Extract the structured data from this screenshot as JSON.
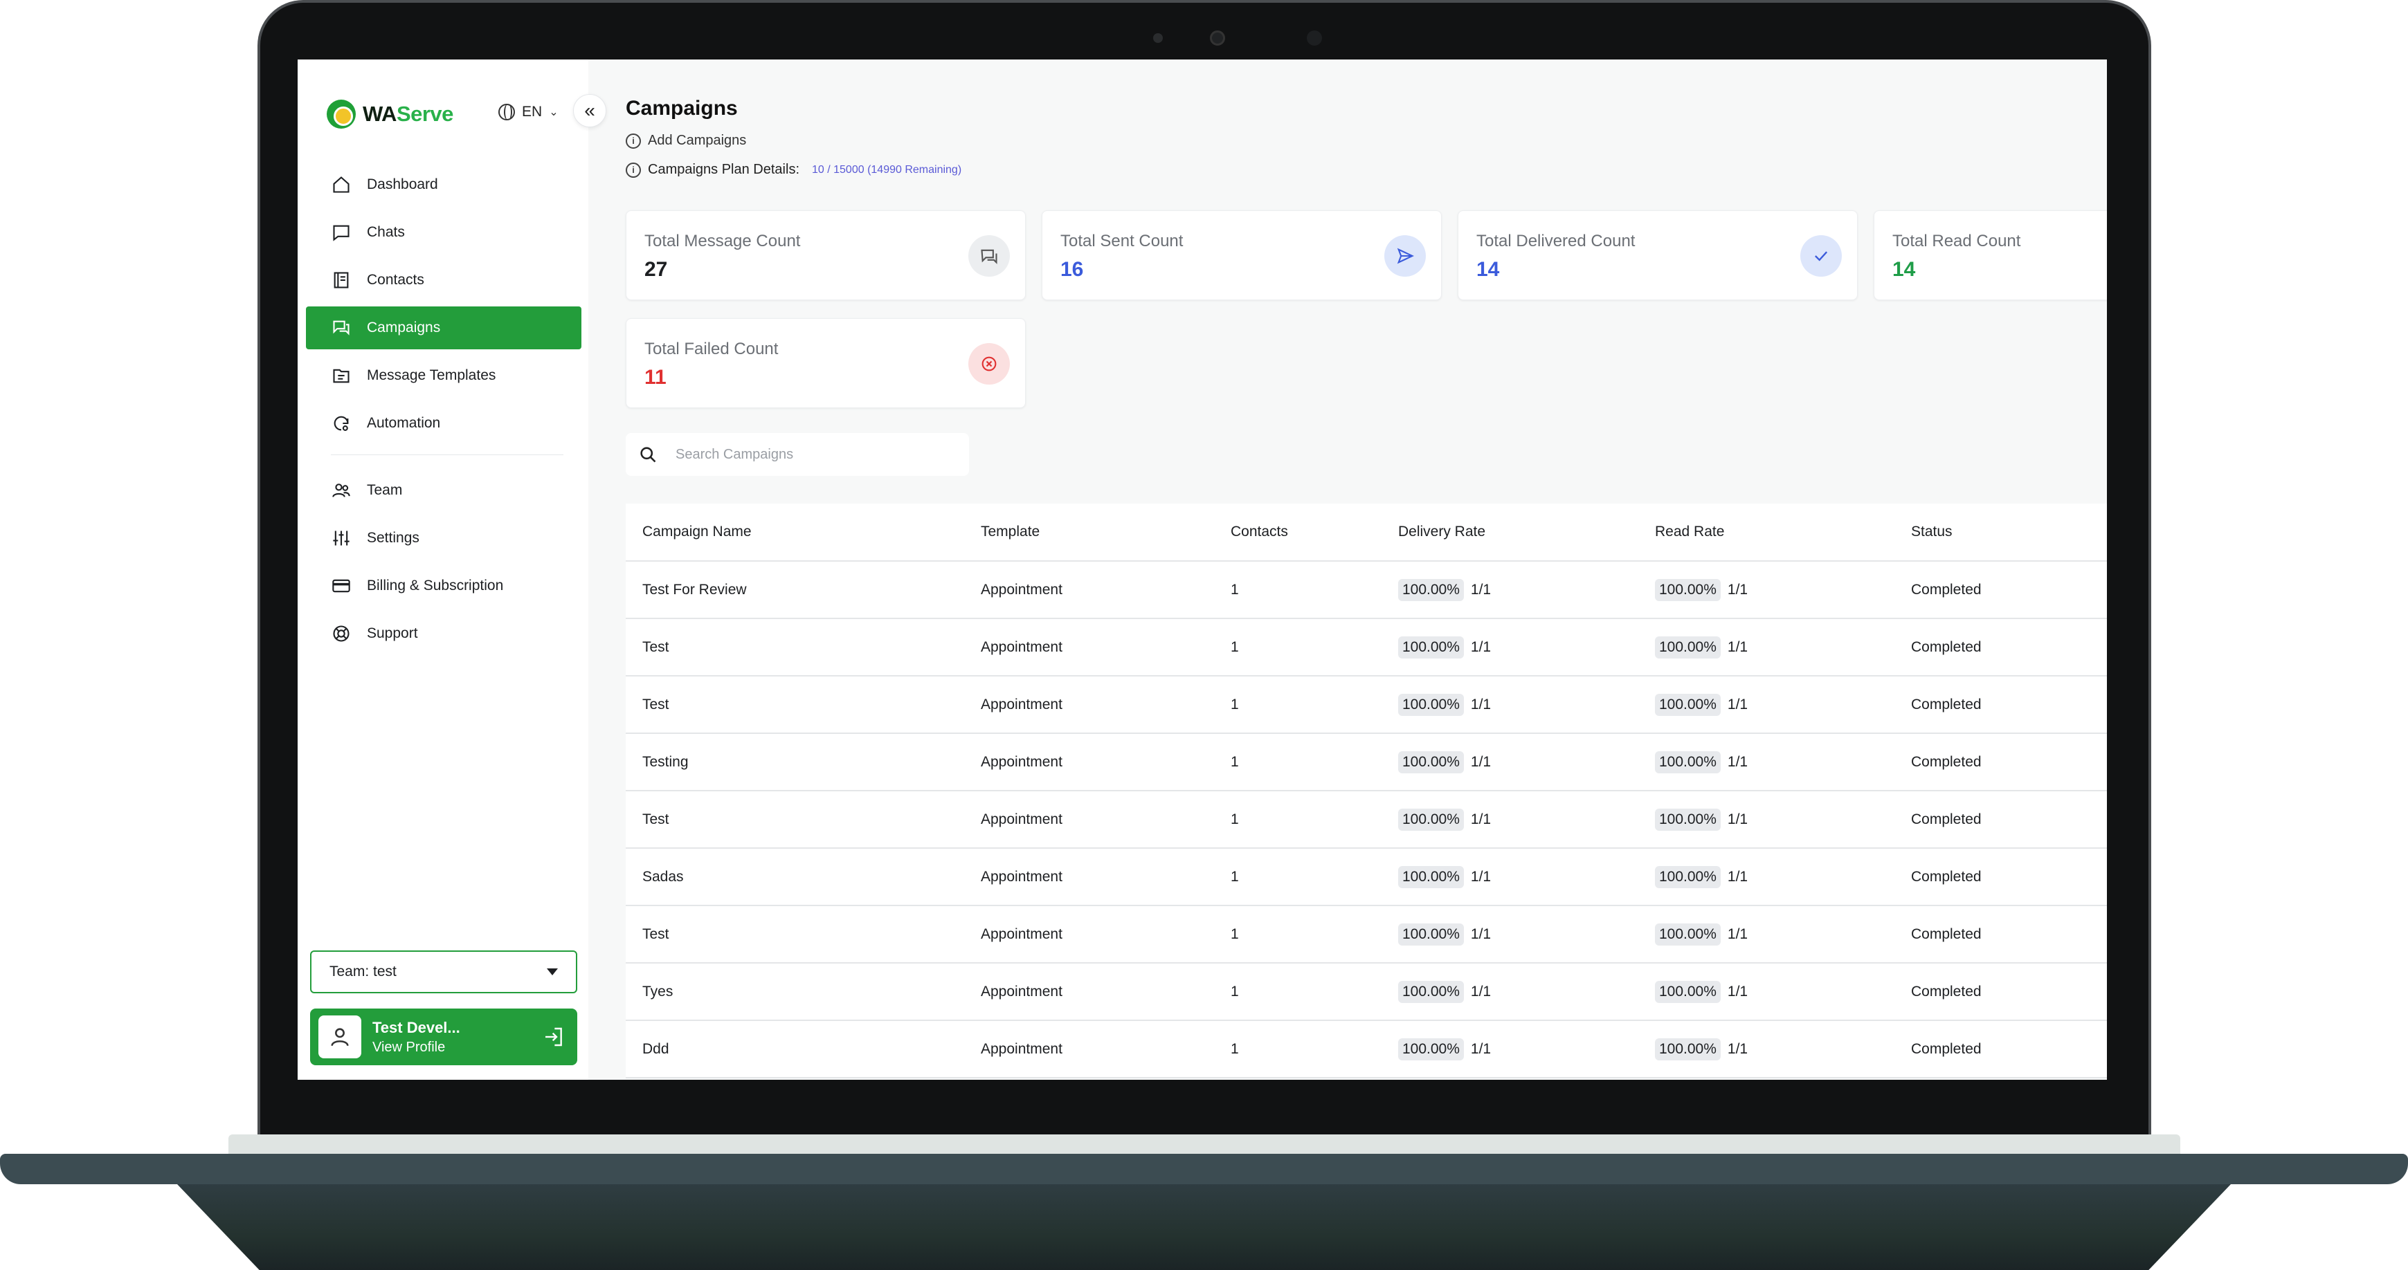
{
  "app": {
    "brand_wa": "WA",
    "brand_serve": "Serve",
    "language": "EN"
  },
  "colors": {
    "primary": "#239d3b",
    "sent": "#3b5bdb",
    "delivered": "#3b5bdb",
    "read": "#1f9d48",
    "failed": "#e03131"
  },
  "sidebar": {
    "items": [
      {
        "label": "Dashboard",
        "icon": "home-icon"
      },
      {
        "label": "Chats",
        "icon": "chat-icon"
      },
      {
        "label": "Contacts",
        "icon": "contacts-book-icon"
      },
      {
        "label": "Campaigns",
        "icon": "campaigns-icon",
        "active": true
      },
      {
        "label": "Message Templates",
        "icon": "templates-folder-icon"
      },
      {
        "label": "Automation",
        "icon": "automation-icon"
      },
      {
        "label": "Team",
        "icon": "team-icon"
      },
      {
        "label": "Settings",
        "icon": "sliders-icon"
      },
      {
        "label": "Billing & Subscription",
        "icon": "credit-card-icon"
      },
      {
        "label": "Support",
        "icon": "lifebuoy-icon"
      }
    ],
    "team_select": "Team: test",
    "profile": {
      "name": "Test Devel...",
      "link": "View Profile"
    }
  },
  "main": {
    "title": "Campaigns",
    "add_link": "Add Campaigns",
    "plan_label": "Campaigns Plan Details:",
    "plan_value": "10 / 15000 (14990 Remaining)",
    "search_placeholder": "Search Campaigns"
  },
  "stats": [
    {
      "label": "Total Message Count",
      "value": "27",
      "icon": "message-icon"
    },
    {
      "label": "Total Sent Count",
      "value": "16",
      "icon": "send-icon"
    },
    {
      "label": "Total Delivered Count",
      "value": "14",
      "icon": "check-icon"
    },
    {
      "label": "Total Read Count",
      "value": "14",
      "icon": "read-icon"
    },
    {
      "label": "Total Failed Count",
      "value": "11",
      "icon": "failed-icon"
    }
  ],
  "table": {
    "headers": [
      "Campaign Name",
      "Template",
      "Contacts",
      "Delivery Rate",
      "Read Rate",
      "Status"
    ],
    "rows": [
      {
        "name": "Test For Review",
        "template": "Appointment",
        "contacts": "1",
        "delivery_pct": "100.00%",
        "delivery_frac": "1/1",
        "read_pct": "100.00%",
        "read_frac": "1/1",
        "status": "Completed"
      },
      {
        "name": "Test",
        "template": "Appointment",
        "contacts": "1",
        "delivery_pct": "100.00%",
        "delivery_frac": "1/1",
        "read_pct": "100.00%",
        "read_frac": "1/1",
        "status": "Completed"
      },
      {
        "name": "Test",
        "template": "Appointment",
        "contacts": "1",
        "delivery_pct": "100.00%",
        "delivery_frac": "1/1",
        "read_pct": "100.00%",
        "read_frac": "1/1",
        "status": "Completed"
      },
      {
        "name": "Testing",
        "template": "Appointment",
        "contacts": "1",
        "delivery_pct": "100.00%",
        "delivery_frac": "1/1",
        "read_pct": "100.00%",
        "read_frac": "1/1",
        "status": "Completed"
      },
      {
        "name": "Test",
        "template": "Appointment",
        "contacts": "1",
        "delivery_pct": "100.00%",
        "delivery_frac": "1/1",
        "read_pct": "100.00%",
        "read_frac": "1/1",
        "status": "Completed"
      },
      {
        "name": "Sadas",
        "template": "Appointment",
        "contacts": "1",
        "delivery_pct": "100.00%",
        "delivery_frac": "1/1",
        "read_pct": "100.00%",
        "read_frac": "1/1",
        "status": "Completed"
      },
      {
        "name": "Test",
        "template": "Appointment",
        "contacts": "1",
        "delivery_pct": "100.00%",
        "delivery_frac": "1/1",
        "read_pct": "100.00%",
        "read_frac": "1/1",
        "status": "Completed"
      },
      {
        "name": "Tyes",
        "template": "Appointment",
        "contacts": "1",
        "delivery_pct": "100.00%",
        "delivery_frac": "1/1",
        "read_pct": "100.00%",
        "read_frac": "1/1",
        "status": "Completed"
      },
      {
        "name": "Ddd",
        "template": "Appointment",
        "contacts": "1",
        "delivery_pct": "100.00%",
        "delivery_frac": "1/1",
        "read_pct": "100.00%",
        "read_frac": "1/1",
        "status": "Completed"
      }
    ]
  }
}
